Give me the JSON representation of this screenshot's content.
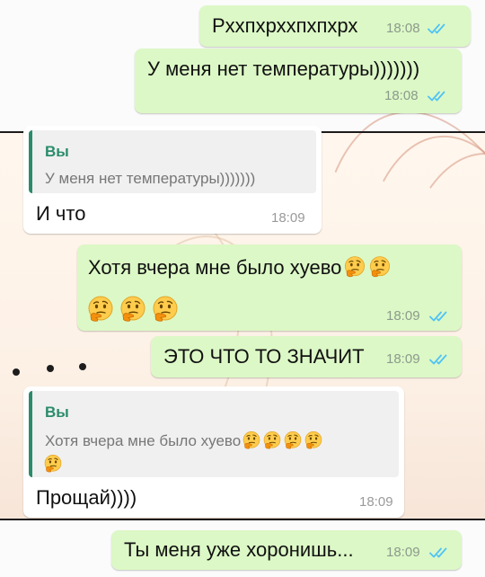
{
  "chat": {
    "messages": [
      {
        "text": "Рххпхрххпхпхрх",
        "time": "18:08",
        "status": "read"
      },
      {
        "text": "У меня нет температуры)))))))",
        "time": "18:08",
        "status": "read"
      },
      {
        "quote_author": "Вы",
        "quote_text": "У меня нет температуры)))))))",
        "text": "И что",
        "time": "18:09"
      },
      {
        "text_line1": "Хотя вчера мне было хуево",
        "time": "18:09",
        "status": "read"
      },
      {
        "text": "ЭТО ЧТО ТО ЗНАЧИТ",
        "time": "18:09",
        "status": "read"
      },
      {
        "quote_author": "Вы",
        "quote_text": "Хотя вчера мне было хуево",
        "text": "Прощай))))",
        "time": "18:09"
      },
      {
        "text": "Ты меня уже хоронишь...",
        "time": "18:09",
        "status": "read"
      }
    ]
  },
  "icons": {
    "read_receipt": "double-check-icon",
    "emoji": "thinking-face-icon"
  },
  "colors": {
    "outgoing": "#dcf8c6",
    "incoming": "#ffffff",
    "tick": "#4fc3f7",
    "quote_accent": "#2a8c6a"
  }
}
